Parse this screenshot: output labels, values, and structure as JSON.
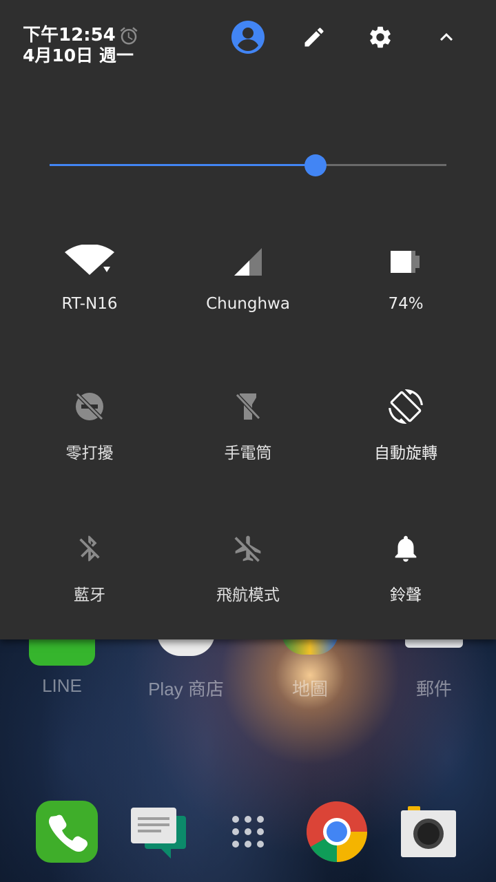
{
  "status": {
    "time": "下午12:54",
    "date": "4月10日 週一"
  },
  "brightness": {
    "level": 0.67
  },
  "tiles": {
    "wifi": {
      "label": "RT-N16"
    },
    "cellular": {
      "label": "Chunghwa"
    },
    "battery": {
      "label": "74%",
      "level": 0.74
    },
    "dnd": {
      "label": "零打擾"
    },
    "flashlight": {
      "label": "手電筒"
    },
    "rotation": {
      "label": "自動旋轉"
    },
    "bluetooth": {
      "label": "藍牙"
    },
    "airplane": {
      "label": "飛航模式"
    },
    "ringer": {
      "label": "鈴聲"
    }
  },
  "home": {
    "apps": [
      "LINE",
      "Play 商店",
      "地圖",
      "郵件"
    ]
  },
  "colors": {
    "panel": "#2f2f2f",
    "accent": "#4285f4",
    "active_icon": "#ffffff",
    "inactive_icon": "#8a8a8a"
  }
}
